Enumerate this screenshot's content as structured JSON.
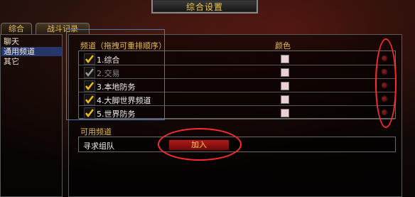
{
  "window": {
    "title": "综合设置"
  },
  "tabs": [
    {
      "label": "综合",
      "active": false
    },
    {
      "label": "战斗记录",
      "active": true
    }
  ],
  "left_menu": {
    "items": [
      {
        "label": "聊天",
        "selected": false
      },
      {
        "label": "通用频道",
        "selected": true
      },
      {
        "label": "其它",
        "selected": false
      }
    ]
  },
  "channels": {
    "header_channel": "频道（拖拽可重排顺序）",
    "header_color": "颜色",
    "rows": [
      {
        "label": "1.综合",
        "checked": true,
        "enabled": true,
        "color": "#ead1d5"
      },
      {
        "label": "2.交易",
        "checked": true,
        "enabled": false,
        "color": "#ead1d5"
      },
      {
        "label": "3.本地防务",
        "checked": true,
        "enabled": true,
        "color": "#ead1d5"
      },
      {
        "label": "4.大脚世界频道",
        "checked": true,
        "enabled": true,
        "color": "#ead1d5"
      },
      {
        "label": "5.世界防务",
        "checked": true,
        "enabled": true,
        "color": "#ead1d5"
      }
    ]
  },
  "available": {
    "header": "可用频道",
    "item_label": "寻求组队",
    "add_button": "加入"
  },
  "colors": {
    "gold_text": "#e3bd57",
    "annotation_red": "#ff2b2b",
    "highlight_blue": "#4f78a6"
  }
}
